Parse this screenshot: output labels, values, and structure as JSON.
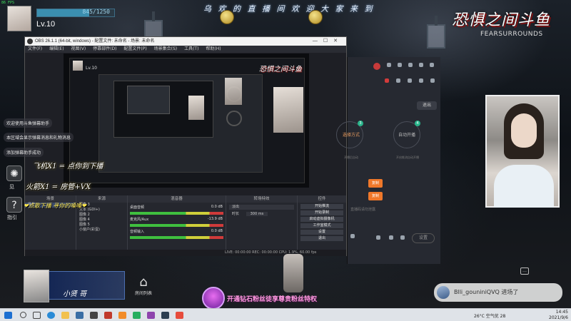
{
  "overlay": {
    "fps_readout": "86 FPS",
    "streamer_level": "Lv.10",
    "level_progress_text": "845/1250",
    "level_progress": 0.68,
    "welcome_banner": "乌 欢 的 直 播 间 欢 迎 大 家 来 到",
    "brand_cn": "恐惧之间斗鱼",
    "brand_en": "FEARSURROUNDS"
  },
  "obs": {
    "title": "OBS 26.1.1 (64-bit, windows) - 配置文件: 未命名 - 场景: 未命名",
    "menu": [
      "文件(F)",
      "编辑(E)",
      "视图(V)",
      "停靠部件(D)",
      "配置文件(P)",
      "场景集合(S)",
      "工具(T)",
      "帮助(H)"
    ],
    "nested_level": "Lv.10",
    "panels": {
      "scenes_head": "场景",
      "sources_head": "来源",
      "mixer_head": "混音器",
      "transitions_head": "转场特效",
      "controls_head": "控件"
    },
    "scene_name": "场景",
    "sources": [
      "图像 3",
      "文本 (GDI+)",
      "图像 2",
      "图像 4",
      "图像 5",
      "小窗户(彩蛋)"
    ],
    "mixer": [
      {
        "name": "桌面音频",
        "db": "0.0 dB"
      },
      {
        "name": "麦克风/Aux",
        "db": "-13.9 dB"
      },
      {
        "name": "音频输入",
        "db": "0.0 dB"
      }
    ],
    "transition": "淡出",
    "duration_label": "时长",
    "duration_value": "300 ms",
    "controls": [
      "开始推流",
      "开始录制",
      "启动虚拟摄像机",
      "工作室模式",
      "设置",
      "退出"
    ],
    "status_bar": "LIVE: 00:00:00   REC: 00:00:00   CPU: 1.9%, 60.00 fps"
  },
  "helper": {
    "top_button": "退出",
    "step1_label": "选择方式",
    "step1_num": "3",
    "step2_label": "自动开播",
    "step2_num": "4",
    "step1_sub": "开播后自动",
    "step2_sub": "开启推流自动开播",
    "orange_btn1": "复制",
    "orange_btn2": "复制",
    "hint": "直播码请勿泄露",
    "settings_button": "设置"
  },
  "chat": [
    "欢迎使用斗鱼弹幕助手",
    "本区域会显示弹幕消息和礼物消息",
    "添加弹幕助手成功"
  ],
  "side": {
    "icon1_label": "见",
    "icon2_label": "指引"
  },
  "fire": {
    "line1": "飞机X1 = 点你到下播",
    "line2": "火箭X1 = 房管+VX",
    "line3": "❤点歌下播 寻你的嗓嗓❤"
  },
  "bottom": {
    "banner_name": "小贤 哥",
    "room_list_label": "房间列表",
    "pink_banner": "开通钻石粉丝徒享尊贵粉丝特权",
    "notification": "Blli_gouniniQVQ 进场了"
  },
  "taskbar": {
    "weather": "26°C 空气优 28",
    "time": "14:45",
    "date": "2021/9/6"
  }
}
